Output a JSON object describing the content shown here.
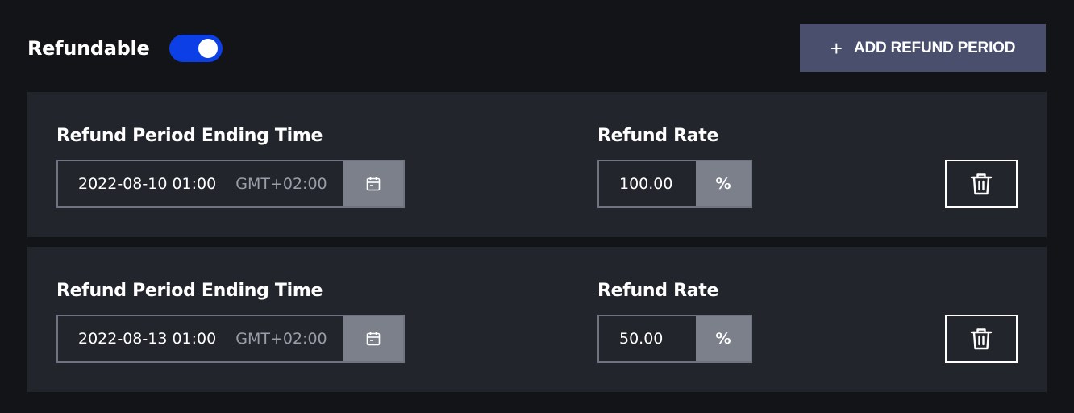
{
  "header": {
    "refundable_label": "Refundable",
    "refundable_on": true,
    "add_button_label": "ADD REFUND PERIOD",
    "add_button_icon": "plus-icon"
  },
  "colors": {
    "background": "#121418",
    "card": "#23252c",
    "toggle_on": "#0d3fe6",
    "add_button": "#4a4f6d",
    "addon": "#7c808b"
  },
  "periods": [
    {
      "time_label": "Refund Period Ending Time",
      "date_value": "2022-08-10 01:00",
      "timezone": "GMT+02:00",
      "rate_label": "Refund Rate",
      "rate_value": "100.00",
      "rate_unit": "%"
    },
    {
      "time_label": "Refund Period Ending Time",
      "date_value": "2022-08-13 01:00",
      "timezone": "GMT+02:00",
      "rate_label": "Refund Rate",
      "rate_value": "50.00",
      "rate_unit": "%"
    }
  ]
}
